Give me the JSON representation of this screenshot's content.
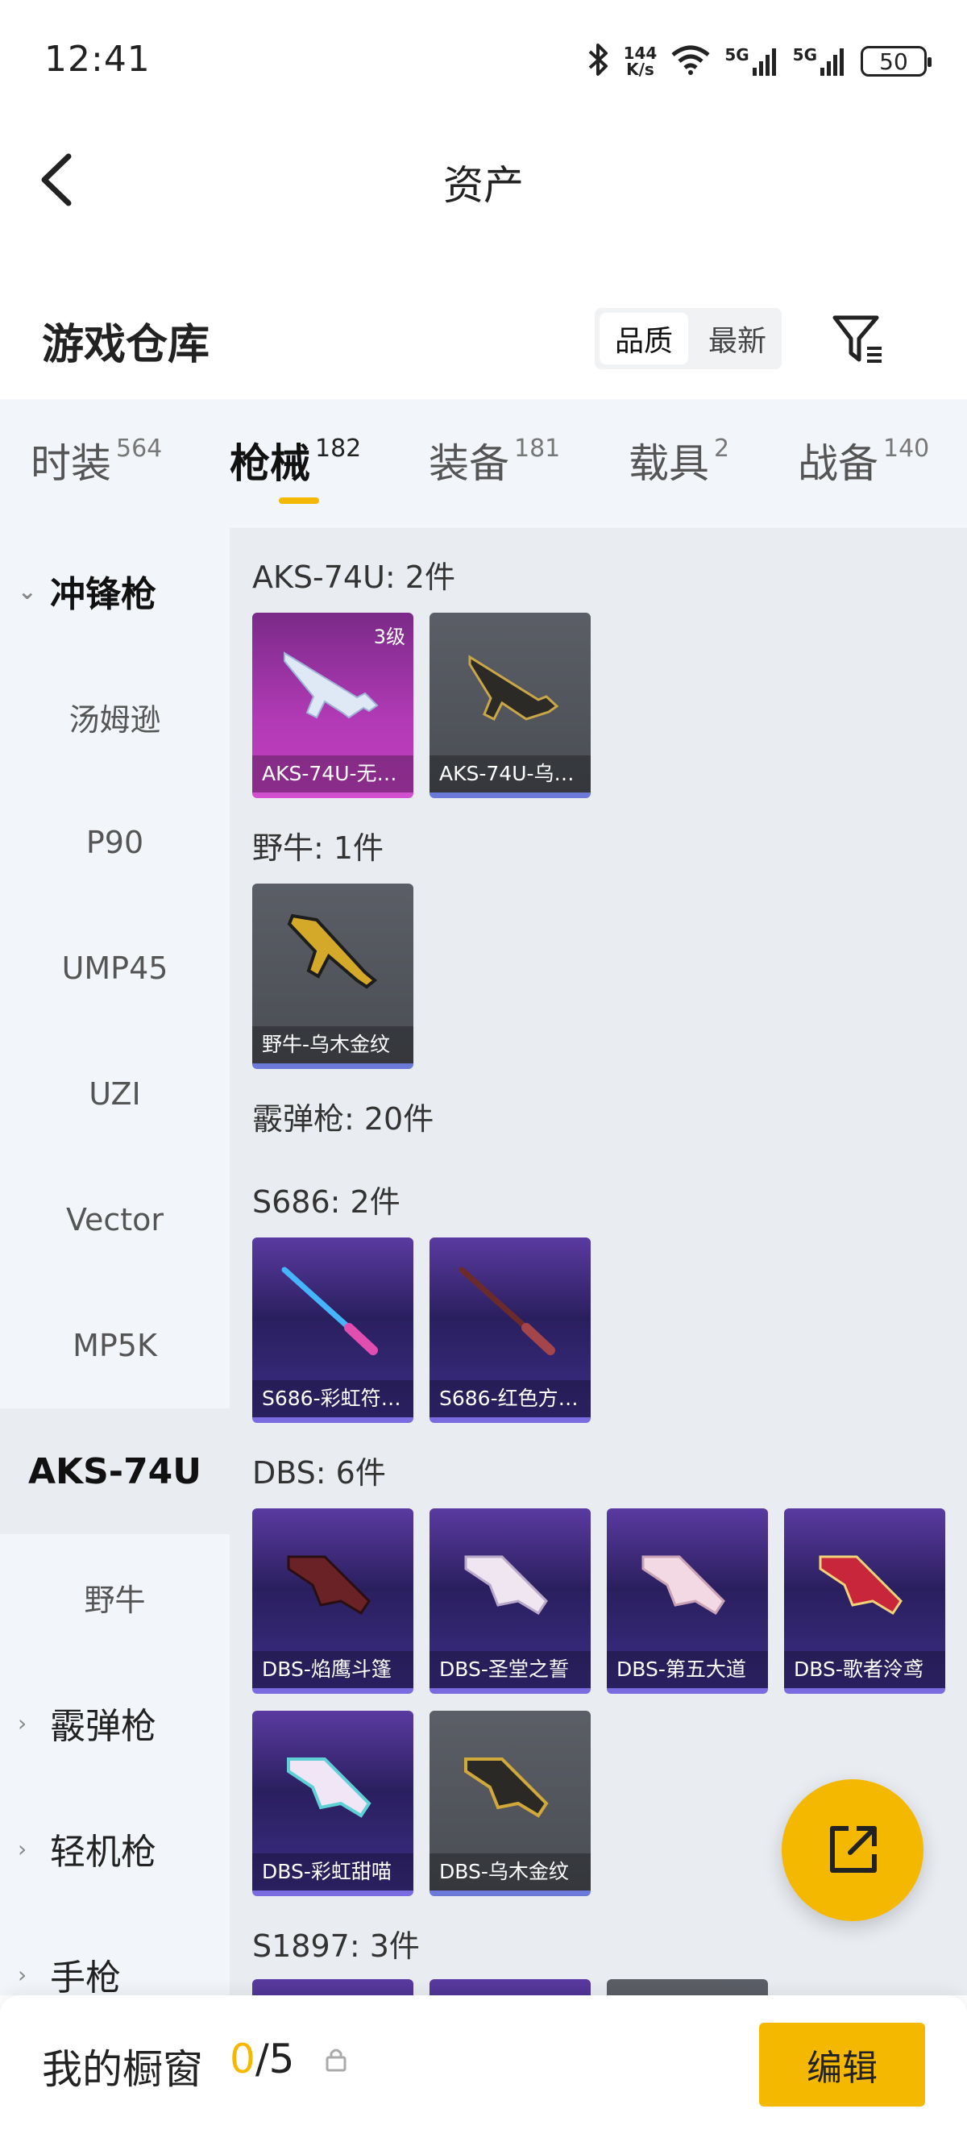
{
  "status_bar": {
    "time": "12:41",
    "net_speed_value": "144",
    "net_speed_unit": "K/s",
    "signal1": "5G",
    "signal2": "5G",
    "battery": "50"
  },
  "header": {
    "title": "资产"
  },
  "warehouse": {
    "title": "游戏仓库",
    "sort_options": [
      "品质",
      "最新"
    ],
    "sort_selected": "品质"
  },
  "tabs": [
    {
      "label": "时装",
      "count": "564"
    },
    {
      "label": "枪械",
      "count": "182",
      "active": true
    },
    {
      "label": "装备",
      "count": "181"
    },
    {
      "label": "载具",
      "count": "2"
    },
    {
      "label": "战备",
      "count": "140"
    }
  ],
  "sidebar": {
    "items": [
      {
        "label": "冲锋枪",
        "type": "parent-open"
      },
      {
        "label": "汤姆逊"
      },
      {
        "label": "P90"
      },
      {
        "label": "UMP45"
      },
      {
        "label": "UZI"
      },
      {
        "label": "Vector"
      },
      {
        "label": "MP5K"
      },
      {
        "label": "AKS-74U",
        "selected": true
      },
      {
        "label": "野牛"
      },
      {
        "label": "霰弹枪",
        "type": "parent"
      },
      {
        "label": "轻机枪",
        "type": "parent"
      },
      {
        "label": "手枪",
        "type": "parent"
      }
    ]
  },
  "main": {
    "sections": [
      {
        "label": "AKS-74U: 2件"
      },
      {
        "label": "野牛: 1件"
      },
      {
        "label": "霰弹枪: 20件"
      },
      {
        "label": "S686: 2件"
      },
      {
        "label": "DBS: 6件"
      },
      {
        "label": "S1897: 3件"
      }
    ],
    "cards": [
      {
        "caption": "AKS-74U-无…",
        "badge": "3级",
        "rarity": "legend"
      },
      {
        "caption": "AKS-74U-乌…",
        "rarity": "gray"
      },
      {
        "caption": "野牛-乌木金纹",
        "rarity": "gray"
      },
      {
        "caption": "S686-彩虹符…",
        "rarity": "epic"
      },
      {
        "caption": "S686-红色方…",
        "rarity": "epic"
      },
      {
        "caption": "DBS-焰鹰斗篷",
        "rarity": "epic"
      },
      {
        "caption": "DBS-圣堂之誓",
        "rarity": "epic"
      },
      {
        "caption": "DBS-第五大道",
        "rarity": "epic"
      },
      {
        "caption": "DBS-歌者泠鸢",
        "rarity": "epic"
      },
      {
        "caption": "DBS-彩虹甜喵",
        "rarity": "epic"
      },
      {
        "caption": "DBS-乌木金纹",
        "rarity": "gray"
      }
    ]
  },
  "bottom_bar": {
    "label": "我的橱窗",
    "current": "0",
    "total": "/5",
    "edit_label": "编辑"
  },
  "colors": {
    "accent": "#f5b800",
    "epic": "#5a3aa0",
    "legend": "#b23ab6"
  }
}
